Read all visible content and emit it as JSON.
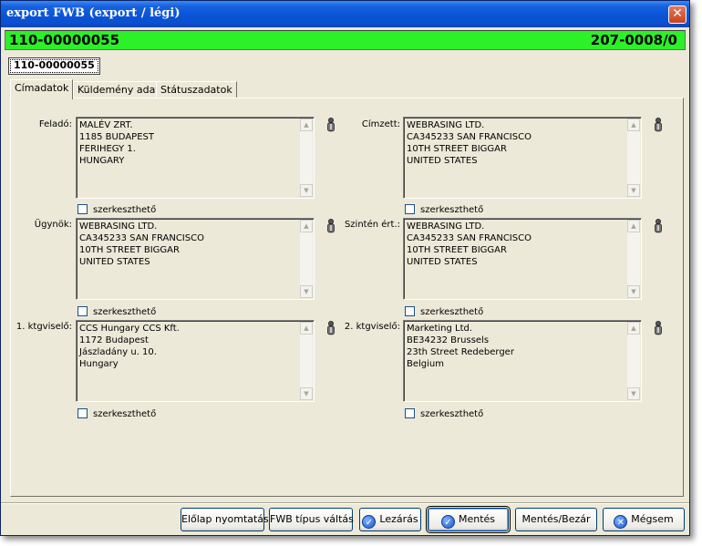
{
  "window": {
    "title": "export FWB (export / légi)"
  },
  "header": {
    "awb_left": "110-00000055",
    "awb_right": "207-0008/0"
  },
  "awb_tab": "110-00000055",
  "tabs": [
    "Címadatok",
    "Küldemény adatai",
    "Státuszadatok"
  ],
  "addresses": {
    "felado": {
      "label": "Feladó:",
      "text": "MALÉV ZRT.\n1185 BUDAPEST\nFERIHEGY 1.\nHUNGARY"
    },
    "cimzett": {
      "label": "Címzett:",
      "text": "WEBRASING LTD.\nCA345233 SAN FRANCISCO\n10TH STREET BIGGAR\nUNITED STATES"
    },
    "ugynok": {
      "label": "Ügynök:",
      "text": "WEBRASING LTD.\nCA345233 SAN FRANCISCO\n10TH STREET BIGGAR\nUNITED STATES"
    },
    "szinten": {
      "label": "Szintén ért.:",
      "text": "WEBRASING LTD.\nCA345233 SAN FRANCISCO\n10TH STREET BIGGAR\nUNITED STATES"
    },
    "ktg1": {
      "label": "1. ktgviselő:",
      "text": "CCS Hungary CCS Kft.\n1172 Budapest\nJászladány u. 10.\nHungary"
    },
    "ktg2": {
      "label": "2. ktgviselő:",
      "text": "Marketing Ltd.\nBE34232 Brussels\n23th Street Redeberger\nBelgium"
    }
  },
  "editable_label": "szerkeszthető",
  "buttons": {
    "print": "Előlap nyomtatás",
    "switch": "FWB típus váltás",
    "close": "Lezárás",
    "save": "Mentés",
    "save_close": "Mentés/Bezár",
    "cancel": "Mégsem"
  },
  "colors": {
    "titlebar": "#0a55d8",
    "header_bar": "#2cf028",
    "window_bg": "#ece9d8"
  }
}
